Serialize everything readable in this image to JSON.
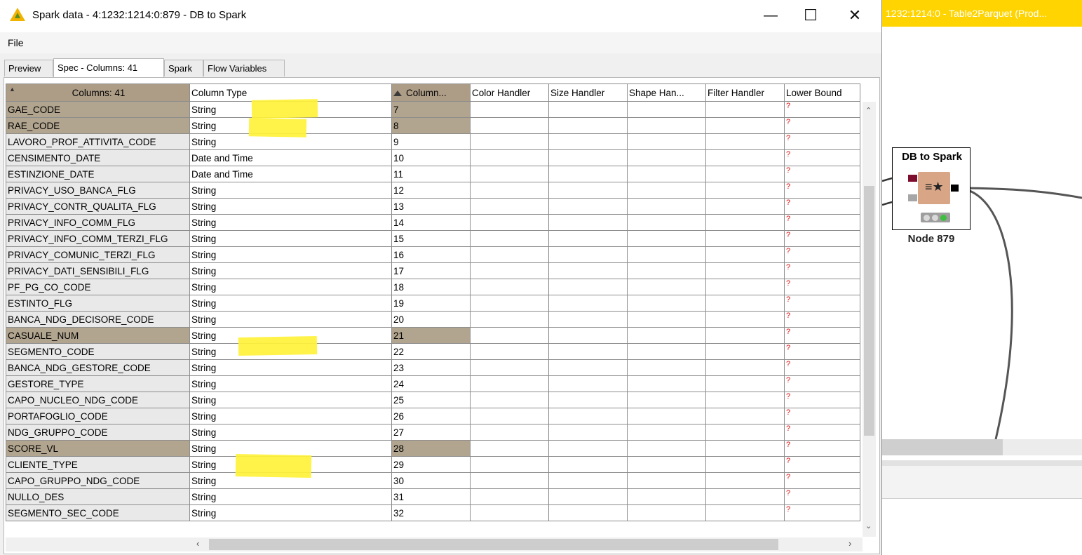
{
  "background": {
    "tab_title": "1232:1214:0 - Table2Parquet (Prod...",
    "node": {
      "title": "DB to Spark",
      "label": "Node 879"
    }
  },
  "window": {
    "title": "Spark data - 4:1232:1214:0:879 - DB to Spark",
    "menu": [
      "File"
    ],
    "tabs": [
      "Preview",
      "Spec - Columns: 41",
      "Spark",
      "Flow Variables"
    ],
    "active_tab": "Spec - Columns: 41"
  },
  "table": {
    "headers": [
      "Columns: 41",
      "Column Type",
      "Column...",
      "Color Handler",
      "Size Handler",
      "Shape Han...",
      "Filter Handler",
      "Lower Bound"
    ],
    "rows": [
      {
        "name": "GAE_CODE",
        "type": "String",
        "pos": "7",
        "lower": "?",
        "selected": true
      },
      {
        "name": "RAE_CODE",
        "type": "String",
        "pos": "8",
        "lower": "?",
        "selected": true
      },
      {
        "name": "LAVORO_PROF_ATTIVITA_CODE",
        "type": "String",
        "pos": "9",
        "lower": "?",
        "selected": false
      },
      {
        "name": "CENSIMENTO_DATE",
        "type": "Date and Time",
        "pos": "10",
        "lower": "?",
        "selected": false
      },
      {
        "name": "ESTINZIONE_DATE",
        "type": "Date and Time",
        "pos": "11",
        "lower": "?",
        "selected": false
      },
      {
        "name": "PRIVACY_USO_BANCA_FLG",
        "type": "String",
        "pos": "12",
        "lower": "?",
        "selected": false
      },
      {
        "name": "PRIVACY_CONTR_QUALITA_FLG",
        "type": "String",
        "pos": "13",
        "lower": "?",
        "selected": false
      },
      {
        "name": "PRIVACY_INFO_COMM_FLG",
        "type": "String",
        "pos": "14",
        "lower": "?",
        "selected": false
      },
      {
        "name": "PRIVACY_INFO_COMM_TERZI_FLG",
        "type": "String",
        "pos": "15",
        "lower": "?",
        "selected": false
      },
      {
        "name": "PRIVACY_COMUNIC_TERZI_FLG",
        "type": "String",
        "pos": "16",
        "lower": "?",
        "selected": false
      },
      {
        "name": "PRIVACY_DATI_SENSIBILI_FLG",
        "type": "String",
        "pos": "17",
        "lower": "?",
        "selected": false
      },
      {
        "name": "PF_PG_CO_CODE",
        "type": "String",
        "pos": "18",
        "lower": "?",
        "selected": false
      },
      {
        "name": "ESTINTO_FLG",
        "type": "String",
        "pos": "19",
        "lower": "?",
        "selected": false
      },
      {
        "name": "BANCA_NDG_DECISORE_CODE",
        "type": "String",
        "pos": "20",
        "lower": "?",
        "selected": false
      },
      {
        "name": "CASUALE_NUM",
        "type": "String",
        "pos": "21",
        "lower": "?",
        "selected": true
      },
      {
        "name": "SEGMENTO_CODE",
        "type": "String",
        "pos": "22",
        "lower": "?",
        "selected": false
      },
      {
        "name": "BANCA_NDG_GESTORE_CODE",
        "type": "String",
        "pos": "23",
        "lower": "?",
        "selected": false
      },
      {
        "name": "GESTORE_TYPE",
        "type": "String",
        "pos": "24",
        "lower": "?",
        "selected": false
      },
      {
        "name": "CAPO_NUCLEO_NDG_CODE",
        "type": "String",
        "pos": "25",
        "lower": "?",
        "selected": false
      },
      {
        "name": "PORTAFOGLIO_CODE",
        "type": "String",
        "pos": "26",
        "lower": "?",
        "selected": false
      },
      {
        "name": "NDG_GRUPPO_CODE",
        "type": "String",
        "pos": "27",
        "lower": "?",
        "selected": false
      },
      {
        "name": "SCORE_VL",
        "type": "String",
        "pos": "28",
        "lower": "?",
        "selected": true
      },
      {
        "name": "CLIENTE_TYPE",
        "type": "String",
        "pos": "29",
        "lower": "?",
        "selected": false
      },
      {
        "name": "CAPO_GRUPPO_NDG_CODE",
        "type": "String",
        "pos": "30",
        "lower": "?",
        "selected": false
      },
      {
        "name": "NULLO_DES",
        "type": "String",
        "pos": "31",
        "lower": "?",
        "selected": false
      },
      {
        "name": "SEGMENTO_SEC_CODE",
        "type": "String",
        "pos": "32",
        "lower": "?",
        "selected": false
      }
    ]
  },
  "colors": {
    "highlight": "#fff23a",
    "selected_row": "#b2a58f",
    "header_sorted": "#ad9d87",
    "missing_marker": "#e01010",
    "workflow_tab": "#ffd400"
  }
}
